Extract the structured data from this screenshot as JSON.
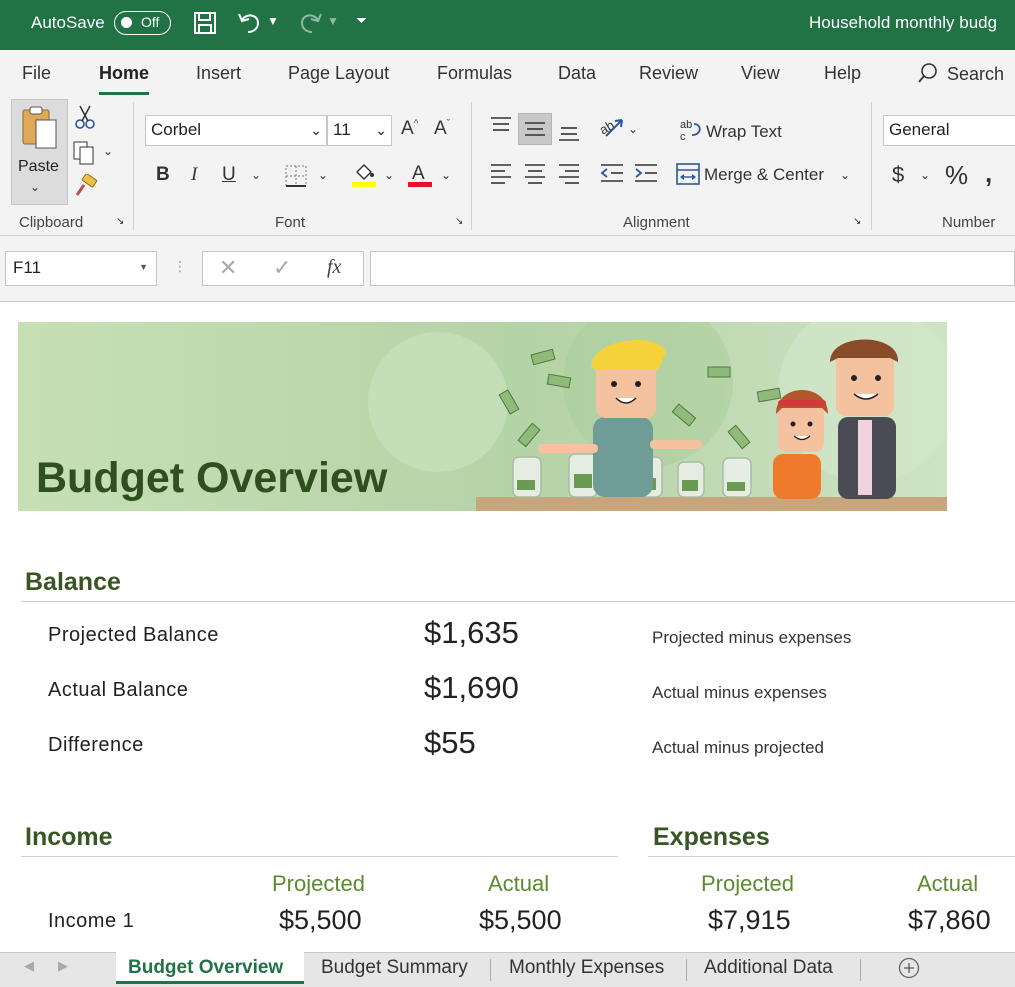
{
  "titlebar": {
    "autosave_label": "AutoSave",
    "autosave_state": "Off",
    "document_title": "Household monthly budg"
  },
  "ribbon_tabs": [
    "File",
    "Home",
    "Insert",
    "Page Layout",
    "Formulas",
    "Data",
    "Review",
    "View",
    "Help"
  ],
  "search_label": "Search",
  "ribbon": {
    "paste_label": "Paste",
    "font_name": "Corbel",
    "font_size": "11",
    "wrap_text": "Wrap Text",
    "merge_center": "Merge & Center",
    "number_format": "General",
    "groups": {
      "clipboard": "Clipboard",
      "font": "Font",
      "alignment": "Alignment",
      "number": "Number"
    },
    "colors": {
      "highlight": "#ffff00",
      "font_color": "#e81123"
    }
  },
  "formula_bar": {
    "name_box": "F11",
    "fx": "fx",
    "formula": ""
  },
  "sheet": {
    "banner_title": "Budget Overview",
    "balance": {
      "title": "Balance",
      "rows": [
        {
          "label": "Projected Balance",
          "value": "$1,635",
          "note": "Projected minus expenses"
        },
        {
          "label": "Actual Balance",
          "value": "$1,690",
          "note": "Actual minus expenses"
        },
        {
          "label": "Difference",
          "value": "$55",
          "note": "Actual minus projected"
        }
      ]
    },
    "income": {
      "title": "Income",
      "col_projected": "Projected",
      "col_actual": "Actual",
      "rows": [
        {
          "label": "Income 1",
          "projected": "$5,500",
          "actual": "$5,500"
        }
      ]
    },
    "expenses": {
      "title": "Expenses",
      "col_projected": "Projected",
      "col_actual": "Actual",
      "projected": "$7,915",
      "actual": "$7,860"
    }
  },
  "sheet_tabs": [
    "Budget Overview",
    "Budget Summary",
    "Monthly Expenses",
    "Additional Data"
  ],
  "accent_color": "#217346"
}
